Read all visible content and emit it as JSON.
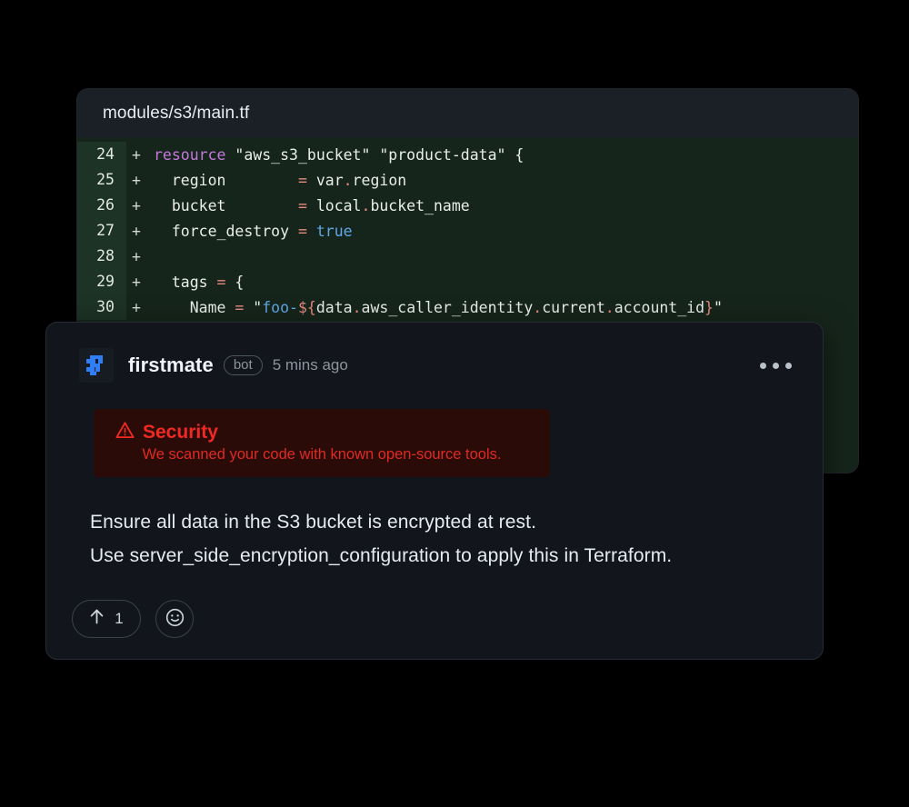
{
  "code_panel": {
    "filename": "modules/s3/main.tf",
    "diff_marker": "+",
    "lines": [
      {
        "number": "24",
        "marker": "+",
        "tokens": [
          {
            "t": "resource",
            "c": "t-kw"
          },
          {
            "t": " ",
            "c": "t-plain"
          },
          {
            "t": "\"aws_s3_bucket\"",
            "c": "t-str"
          },
          {
            "t": " ",
            "c": "t-plain"
          },
          {
            "t": "\"product-data\"",
            "c": "t-str"
          },
          {
            "t": " {",
            "c": "t-plain"
          }
        ]
      },
      {
        "number": "25",
        "marker": "+",
        "tokens": [
          {
            "t": "  region        ",
            "c": "t-plain"
          },
          {
            "t": "=",
            "c": "t-op"
          },
          {
            "t": " var",
            "c": "t-plain"
          },
          {
            "t": ".",
            "c": "t-dot"
          },
          {
            "t": "region",
            "c": "t-plain"
          }
        ]
      },
      {
        "number": "26",
        "marker": "+",
        "tokens": [
          {
            "t": "  bucket        ",
            "c": "t-plain"
          },
          {
            "t": "=",
            "c": "t-op"
          },
          {
            "t": " local",
            "c": "t-plain"
          },
          {
            "t": ".",
            "c": "t-dot"
          },
          {
            "t": "bucket_name",
            "c": "t-plain"
          }
        ]
      },
      {
        "number": "27",
        "marker": "+",
        "tokens": [
          {
            "t": "  force_destroy ",
            "c": "t-plain"
          },
          {
            "t": "=",
            "c": "t-op"
          },
          {
            "t": " ",
            "c": "t-plain"
          },
          {
            "t": "true",
            "c": "t-bool"
          }
        ]
      },
      {
        "number": "28",
        "marker": "+",
        "tokens": [
          {
            "t": "",
            "c": "t-plain"
          }
        ]
      },
      {
        "number": "29",
        "marker": "+",
        "tokens": [
          {
            "t": "  tags ",
            "c": "t-plain"
          },
          {
            "t": "=",
            "c": "t-op"
          },
          {
            "t": " {",
            "c": "t-plain"
          }
        ]
      },
      {
        "number": "30",
        "marker": "+",
        "tokens": [
          {
            "t": "    Name ",
            "c": "t-plain"
          },
          {
            "t": "=",
            "c": "t-op"
          },
          {
            "t": " ",
            "c": "t-plain"
          },
          {
            "t": "\"",
            "c": "t-str"
          },
          {
            "t": "foo-",
            "c": "t-var"
          },
          {
            "t": "${",
            "c": "t-interp"
          },
          {
            "t": "data",
            "c": "t-plain"
          },
          {
            "t": ".",
            "c": "t-dot"
          },
          {
            "t": "aws_caller_identity",
            "c": "t-plain"
          },
          {
            "t": ".",
            "c": "t-dot"
          },
          {
            "t": "current",
            "c": "t-plain"
          },
          {
            "t": ".",
            "c": "t-dot"
          },
          {
            "t": "account_id",
            "c": "t-plain"
          },
          {
            "t": "}",
            "c": "t-interp"
          },
          {
            "t": "\"",
            "c": "t-str"
          }
        ]
      }
    ]
  },
  "comment": {
    "avatar_icon": "firstmate-logo-icon",
    "author": "firstmate",
    "badge": "bot",
    "timestamp": "5 mins ago",
    "more_menu_icon": "kebab-menu-icon",
    "alert": {
      "icon": "warning-triangle-icon",
      "title": "Security",
      "subtitle": "We scanned your code with known open-source tools."
    },
    "body_lines": [
      "Ensure all data in the S3 bucket is encrypted at rest.",
      "Use server_side_encryption_configuration to apply this in Terraform."
    ],
    "footer": {
      "upvote_icon": "arrow-up-icon",
      "upvote_count": "1",
      "emoji_icon": "smiley-face-icon"
    }
  },
  "colors": {
    "page_background": "#000000",
    "code_header_bg": "#1b2026",
    "code_body_bg": "#16251b",
    "gutter_bg": "#1d3325",
    "card_bg": "#12161c",
    "alert_bg": "#2b0b08",
    "alert_accent": "#f02a22",
    "brand_blue": "#2f7ef5"
  }
}
